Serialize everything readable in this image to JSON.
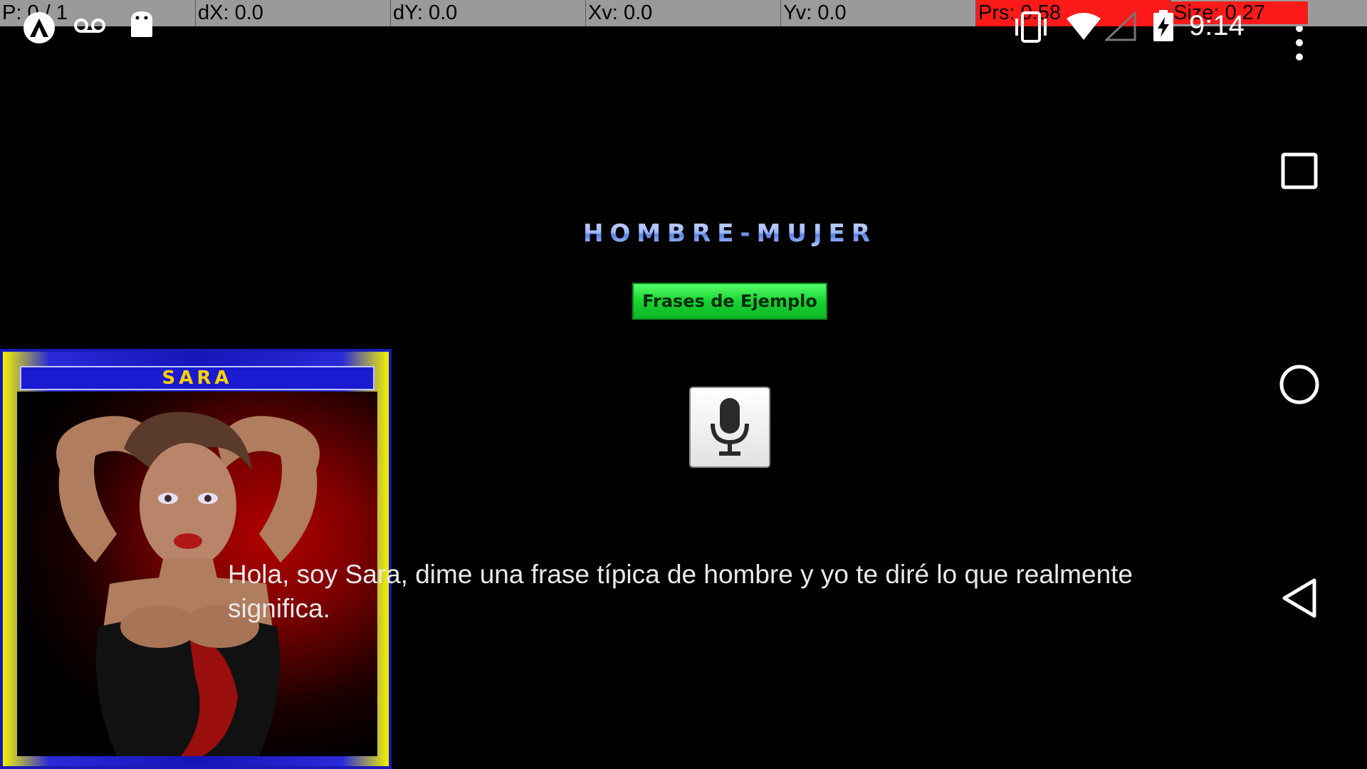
{
  "debug_overlay": {
    "pointer": "P: 0 / 1",
    "dx": "dX: 0.0",
    "dy": "dY: 0.0",
    "xv": "Xv: 0.0",
    "yv": "Yv: 0.0",
    "prs": "Prs: 0.58",
    "size": "Size: 0.27",
    "highlight_color": "#ff1a1a"
  },
  "status_bar": {
    "time": "9:14",
    "icons": [
      "app-icon",
      "voicemail-icon",
      "android-icon",
      "vibrate-icon",
      "wifi-icon",
      "signal-icon",
      "battery-charging-icon"
    ]
  },
  "nav_bar": {
    "buttons": [
      "overflow-menu-icon",
      "recents-icon",
      "home-icon",
      "back-icon"
    ]
  },
  "app": {
    "title": "HOMBRE-MUJER",
    "examples_button": "Frases de Ejemplo",
    "mic_button_icon": "microphone-icon",
    "character_name": "SARA",
    "message": "Hola, soy Sara, dime una frase típica de hombre y yo te diré lo que realmente significa.",
    "colors": {
      "button_green": "#18d431",
      "card_blue": "#1a1ad0",
      "card_yellow": "#f5f200",
      "name_gold": "#ffd200"
    }
  }
}
